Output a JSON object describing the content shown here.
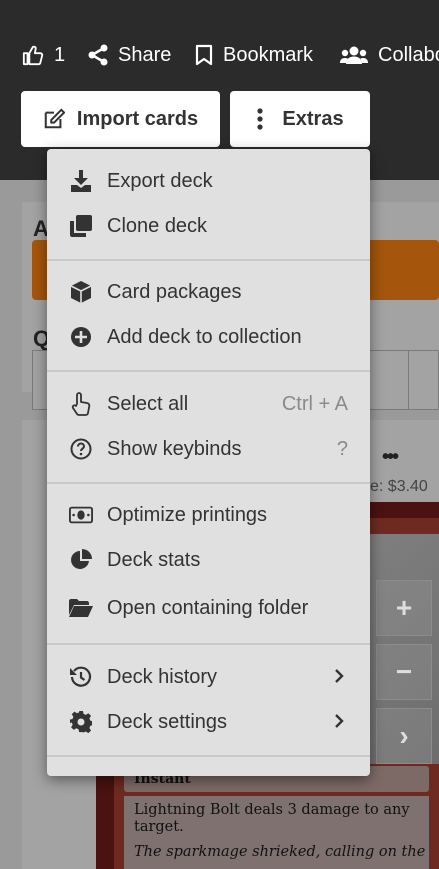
{
  "header": {
    "like_count": "1",
    "share_label": "Share",
    "bookmark_label": "Bookmark",
    "collab_label": "Collabo",
    "import_label": "Import cards",
    "extras_label": "Extras"
  },
  "background": {
    "panel_letter_a": "A",
    "panel_letter_q": "Q",
    "more_dots": "•••",
    "price": "e: $3.40",
    "card": {
      "type_line": "Instant",
      "rules_text": "Lightning Bolt deals 3 damage to any target.",
      "flavor_text": "The sparkmage shrieked, calling on the"
    },
    "side_buttons": {
      "plus": "+",
      "minus": "−",
      "next": "›"
    }
  },
  "menu": {
    "items": [
      {
        "label": "Export deck",
        "icon": "download-icon"
      },
      {
        "label": "Clone deck",
        "icon": "clone-icon"
      },
      {
        "label": "Card packages",
        "icon": "box-icon"
      },
      {
        "label": "Add deck to collection",
        "icon": "plus-circle-icon"
      },
      {
        "label": "Select all",
        "icon": "hand-pointer-icon",
        "shortcut": "Ctrl + A"
      },
      {
        "label": "Show keybinds",
        "icon": "question-circle-icon",
        "shortcut": "?"
      },
      {
        "label": "Optimize printings",
        "icon": "money-icon"
      },
      {
        "label": "Deck stats",
        "icon": "pie-chart-icon"
      },
      {
        "label": "Open containing folder",
        "icon": "folder-open-icon"
      },
      {
        "label": "Deck history",
        "icon": "history-icon"
      },
      {
        "label": "Deck settings",
        "icon": "gear-icon"
      }
    ]
  }
}
